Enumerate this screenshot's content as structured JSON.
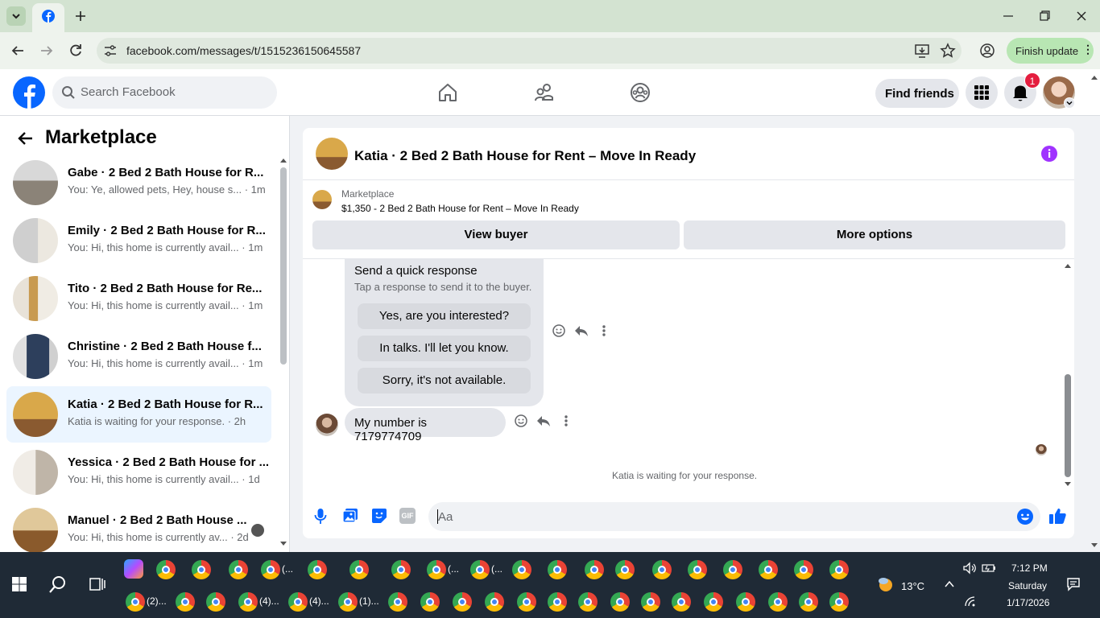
{
  "browser": {
    "url": "facebook.com/messages/t/1515236150645587",
    "finish_update": "Finish update",
    "window_controls": [
      "minimize-icon",
      "restore-icon",
      "close-icon"
    ]
  },
  "header": {
    "search_placeholder": "Search Facebook",
    "find_friends": "Find friends",
    "notification_count": "1",
    "brand_color": "#0866ff"
  },
  "sidebar": {
    "title": "Marketplace",
    "conversations": [
      {
        "name": "Gabe · 2 Bed 2 Bath House for R...",
        "preview": "You: Ye, allowed pets, Hey, house s...",
        "time": "1m",
        "selected": false
      },
      {
        "name": "Emily · 2 Bed 2 Bath House for R...",
        "preview": "You: Hi, this home is currently avail...",
        "time": "1m",
        "selected": false
      },
      {
        "name": "Tito · 2 Bed 2 Bath House for Re...",
        "preview": "You: Hi, this home is currently avail...",
        "time": "1m",
        "selected": false
      },
      {
        "name": "Christine · 2 Bed 2 Bath House f...",
        "preview": "You: Hi, this home is currently avail...",
        "time": "1m",
        "selected": false
      },
      {
        "name": "Katia · 2 Bed 2 Bath House for R...",
        "preview": "Katia is waiting for your response.",
        "time": "2h",
        "selected": true
      },
      {
        "name": "Yessica · 2 Bed 2 Bath House for ...",
        "preview": "You: Hi, this home is currently avail...",
        "time": "1d",
        "selected": false
      },
      {
        "name": "Manuel · 2 Bed 2 Bath House ...",
        "preview": "You: Hi, this home is currently av...",
        "time": "2d",
        "selected": false
      }
    ]
  },
  "chat": {
    "title": "Katia · 2 Bed 2 Bath House for Rent – Move In Ready",
    "marketplace_label": "Marketplace",
    "listing": "$1,350 - 2 Bed 2 Bath House for Rent – Move In Ready",
    "view_buyer": "View buyer",
    "more_options": "More options",
    "quick_response_title": "Send a quick response",
    "quick_response_sub": "Tap a response to send it to the buyer.",
    "quick_responses": [
      "Yes, are you interested?",
      "In talks. I'll let you know.",
      "Sorry, it's not available."
    ],
    "message": "My number is 7179774709",
    "waiting": "Katia is waiting for your response.",
    "compose_placeholder": "Aa"
  },
  "taskbar": {
    "labels": [
      "(...",
      "(...",
      "(...",
      "(2)...",
      "(4)...",
      "(4)...",
      "(1)..."
    ],
    "temperature": "13°C",
    "time": "7:12 PM",
    "day": "Saturday",
    "date": "1/17/2026"
  }
}
